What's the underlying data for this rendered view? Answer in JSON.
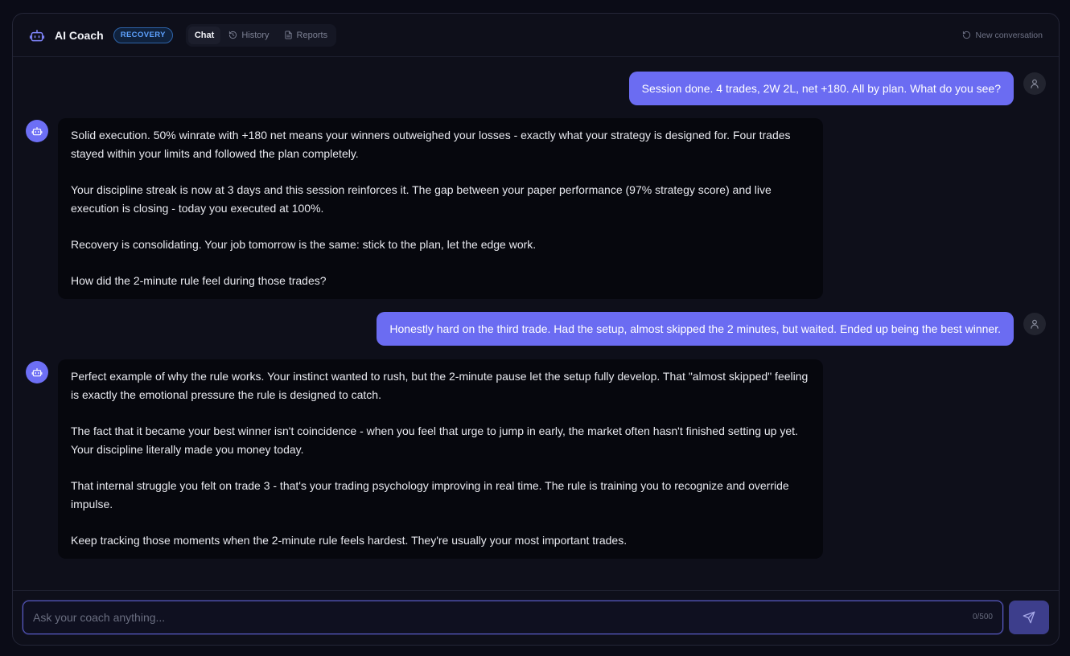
{
  "header": {
    "app_icon": "bot-icon",
    "title": "AI Coach",
    "badge": "RECOVERY",
    "tabs": [
      {
        "label": "Chat",
        "icon": null,
        "active": true
      },
      {
        "label": "History",
        "icon": "history-icon",
        "active": false
      },
      {
        "label": "Reports",
        "icon": "document-icon",
        "active": false
      }
    ],
    "new_conversation_label": "New conversation",
    "new_conversation_icon": "refresh-icon"
  },
  "messages": [
    {
      "role": "user",
      "text": "Session done. 4 trades, 2W 2L, net +180. All by plan. What do you see?"
    },
    {
      "role": "assistant",
      "paragraphs": [
        "Solid execution. 50% winrate with +180 net means your winners outweighed your losses - exactly what your strategy is designed for. Four trades stayed within your limits and followed the plan completely.",
        "Your discipline streak is now at 3 days and this session reinforces it. The gap between your paper performance (97% strategy score) and live execution is closing - today you executed at 100%.",
        "Recovery is consolidating. Your job tomorrow is the same: stick to the plan, let the edge work.",
        "How did the 2-minute rule feel during those trades?"
      ]
    },
    {
      "role": "user",
      "text": "Honestly hard on the third trade. Had the setup, almost skipped the 2 minutes, but waited. Ended up being the best winner."
    },
    {
      "role": "assistant",
      "paragraphs": [
        "Perfect example of why the rule works. Your instinct wanted to rush, but the 2-minute pause let the setup fully develop. That \"almost skipped\" feeling is exactly the emotional pressure the rule is designed to catch.",
        "The fact that it became your best winner isn't coincidence - when you feel that urge to jump in early, the market often hasn't finished setting up yet. Your discipline literally made you money today.",
        "That internal struggle you felt on trade 3 - that's your trading psychology improving in real time. The rule is training you to recognize and override impulse.",
        "Keep tracking those moments when the 2-minute rule feels hardest. They're usually your most important trades."
      ]
    }
  ],
  "composer": {
    "placeholder": "Ask your coach anything...",
    "counter": "0/500",
    "send_icon": "send-icon"
  },
  "colors": {
    "accent": "#6b6cf2",
    "badge": "#5ea2ff",
    "background": "#0e0f1a"
  }
}
